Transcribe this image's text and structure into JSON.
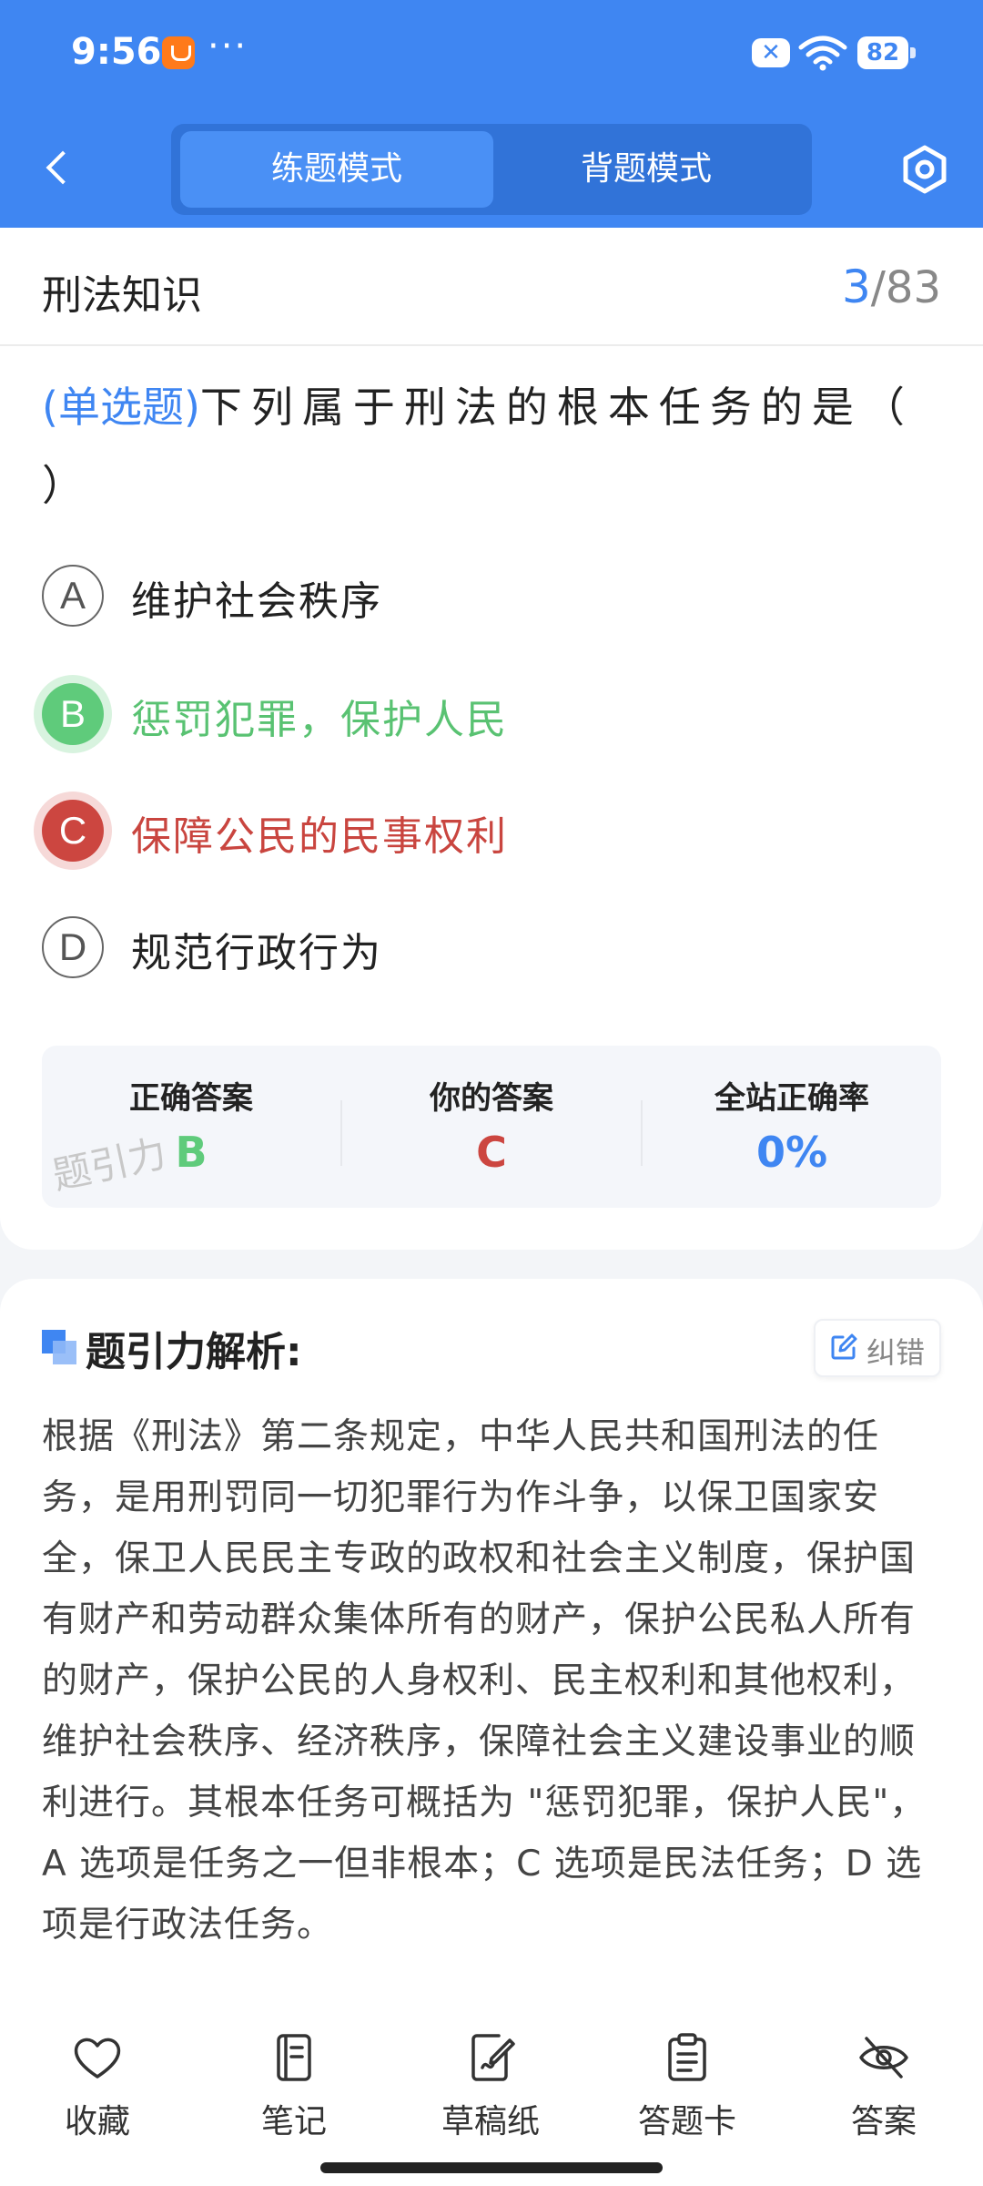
{
  "status_bar": {
    "time": "9:56",
    "dots": "···",
    "battery": "82",
    "icons": [
      "app-notification-icon",
      "close-badge-icon",
      "wifi-icon",
      "battery-icon"
    ]
  },
  "header": {
    "back_icon": "chevron-left-icon",
    "modes": [
      "练题模式",
      "背题模式"
    ],
    "active_mode": "练题模式",
    "settings_icon": "gear-icon"
  },
  "question_card": {
    "subject": "刑法知识",
    "current": "3",
    "separator": "/",
    "total": "83",
    "question_type": "(单选题)",
    "question_text": "下列属于刑法的根本任务的是（ ）",
    "options": [
      {
        "letter": "A",
        "text": "维护社会秩序",
        "state": "normal"
      },
      {
        "letter": "B",
        "text": "惩罚犯罪，保护人民",
        "state": "correct"
      },
      {
        "letter": "C",
        "text": "保障公民的民事权利",
        "state": "wrong"
      },
      {
        "letter": "D",
        "text": "规范行政行为",
        "state": "normal"
      }
    ],
    "summary": {
      "correct_label": "正确答案",
      "correct_value": "B",
      "your_label": "你的答案",
      "your_value": "C",
      "rate_label": "全站正确率",
      "rate_value": "0%"
    },
    "watermark": "题引力"
  },
  "analysis": {
    "title": "题引力解析:",
    "report_label": "纠错",
    "text": "根据《刑法》第二条规定，中华人民共和国刑法的任务，是用刑罚同一切犯罪行为作斗争，以保卫国家安全，保卫人民民主专政的政权和社会主义制度，保护国有财产和劳动群众集体所有的财产，保护公民私人所有的财产，保护公民的人身权利、民主权利和其他权利，维护社会秩序、经济秩序，保障社会主义建设事业的顺利进行。其根本任务可概括为 \"惩罚犯罪，保护人民\"，A 选项是任务之一但非根本；C 选项是民法任务；D 选项是行政法任务。"
  },
  "toolbar": {
    "items": [
      {
        "label": "收藏",
        "icon": "heart-icon"
      },
      {
        "label": "笔记",
        "icon": "notebook-icon"
      },
      {
        "label": "草稿纸",
        "icon": "draft-paper-icon"
      },
      {
        "label": "答题卡",
        "icon": "answer-sheet-icon"
      },
      {
        "label": "答案",
        "icon": "eye-off-icon"
      }
    ]
  },
  "colors": {
    "primary": "#3f86f2",
    "correct": "#5fcb7b",
    "wrong": "#cc4640"
  }
}
